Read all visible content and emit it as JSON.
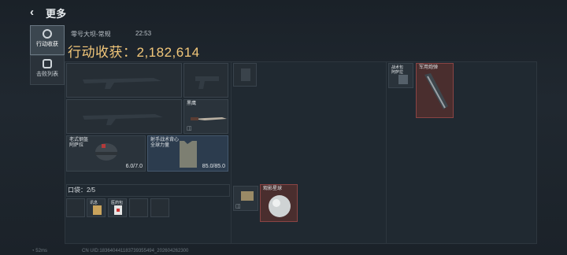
{
  "header": {
    "back_icon": "‹",
    "title": "更多"
  },
  "side_tabs": [
    {
      "label": "行动收获",
      "icon": "target-icon",
      "active": true
    },
    {
      "label": "击败列表",
      "icon": "skull-icon",
      "active": false
    }
  ],
  "match": {
    "map": "零号大坝-常规",
    "time": "22:53"
  },
  "harvest_label": "行动收获：2,182,614",
  "equipment": {
    "helmet": {
      "name": "老式钢盔\n阿萨拉",
      "durability": "6.0/7.0"
    },
    "armor": {
      "name": "射手战术背心\n全球力量",
      "durability": "85.0/85.0"
    },
    "melee": {
      "name": "黑鹰"
    }
  },
  "pocket": {
    "label": "口袋：2/5",
    "items": [
      "讯息",
      "医药包"
    ]
  },
  "backpack_items": [
    "局部战术",
    "观影星球"
  ],
  "right_items": [
    "战术包\n阿萨拉",
    "军用炮弹"
  ],
  "footer": {
    "ping": "52ms",
    "uid": "CN UID:1836404411837393554​94_20260426​2300"
  },
  "colors": {
    "harvest": "#f2c77a",
    "red_tier": "#8a4444",
    "blue_tier": "#44586d"
  }
}
